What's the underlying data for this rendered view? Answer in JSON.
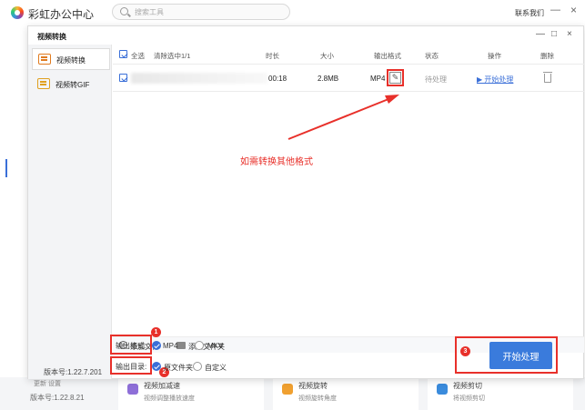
{
  "app": {
    "title": "彩虹办公中心",
    "search_placeholder": "搜索工具",
    "contact": "联系我们",
    "minimize": "—",
    "close": "×",
    "footer_partial": "更新    设置",
    "footer_version": "版本号:1.22.8.21",
    "cards": [
      {
        "title": "视频加减速",
        "desc": "视频调整播放速度",
        "icon_color": "#8e6fd8"
      },
      {
        "title": "视频旋转",
        "desc": "视频旋转角度",
        "icon_color": "#f0a030"
      },
      {
        "title": "视频剪切",
        "desc": "将视频剪切",
        "icon_color": "#3a8bdc"
      }
    ]
  },
  "dialog": {
    "title": "视频转换",
    "controls": {
      "minimize": "—",
      "maximize": "□",
      "close": "×"
    },
    "sidebar": {
      "items": [
        {
          "label": "视频转换",
          "icon": "video-convert-icon",
          "active": true
        },
        {
          "label": "视频转GIF",
          "icon": "gif-icon",
          "active": false
        }
      ],
      "version": "版本号:1.22.7.201"
    },
    "table": {
      "headers": {
        "select_all": "全选",
        "clear_selected": "清除选中1/1",
        "duration": "时长",
        "size": "大小",
        "output_format": "输出格式",
        "status": "状态",
        "action": "操作",
        "delete": "删除"
      },
      "rows": [
        {
          "duration": "00:18",
          "size": "2.8MB",
          "format": "MP4",
          "status": "待处理",
          "action": "▶ 开始处理"
        }
      ]
    },
    "annotation": "如需转换其他格式",
    "add_file": "添加文件",
    "add_folder": "添加文件夹",
    "output_format_label": "输出格式:",
    "format_options": [
      "MP4",
      "MKV"
    ],
    "output_dir_label": "输出目录:",
    "dir_options": [
      "原文件夹",
      "自定义"
    ],
    "badges": [
      "1",
      "2",
      "3"
    ],
    "start_button": "开始处理"
  },
  "colors": {
    "accent": "#3a7bdc",
    "highlight": "#e8302a"
  }
}
